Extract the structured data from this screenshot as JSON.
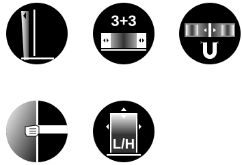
{
  "icons": [
    {
      "id": "plumb-level-icon",
      "text": ""
    },
    {
      "id": "three-plus-three-icon",
      "text": "3+3"
    },
    {
      "id": "magnet-lock-icon",
      "text": ""
    },
    {
      "id": "hand-grip-icon",
      "text": ""
    },
    {
      "id": "left-hand-right-hand-icon",
      "text": "L/H"
    }
  ],
  "colors": {
    "circle": "#000000",
    "foreground": "#ffffff",
    "gradient_dark": "#333333"
  }
}
